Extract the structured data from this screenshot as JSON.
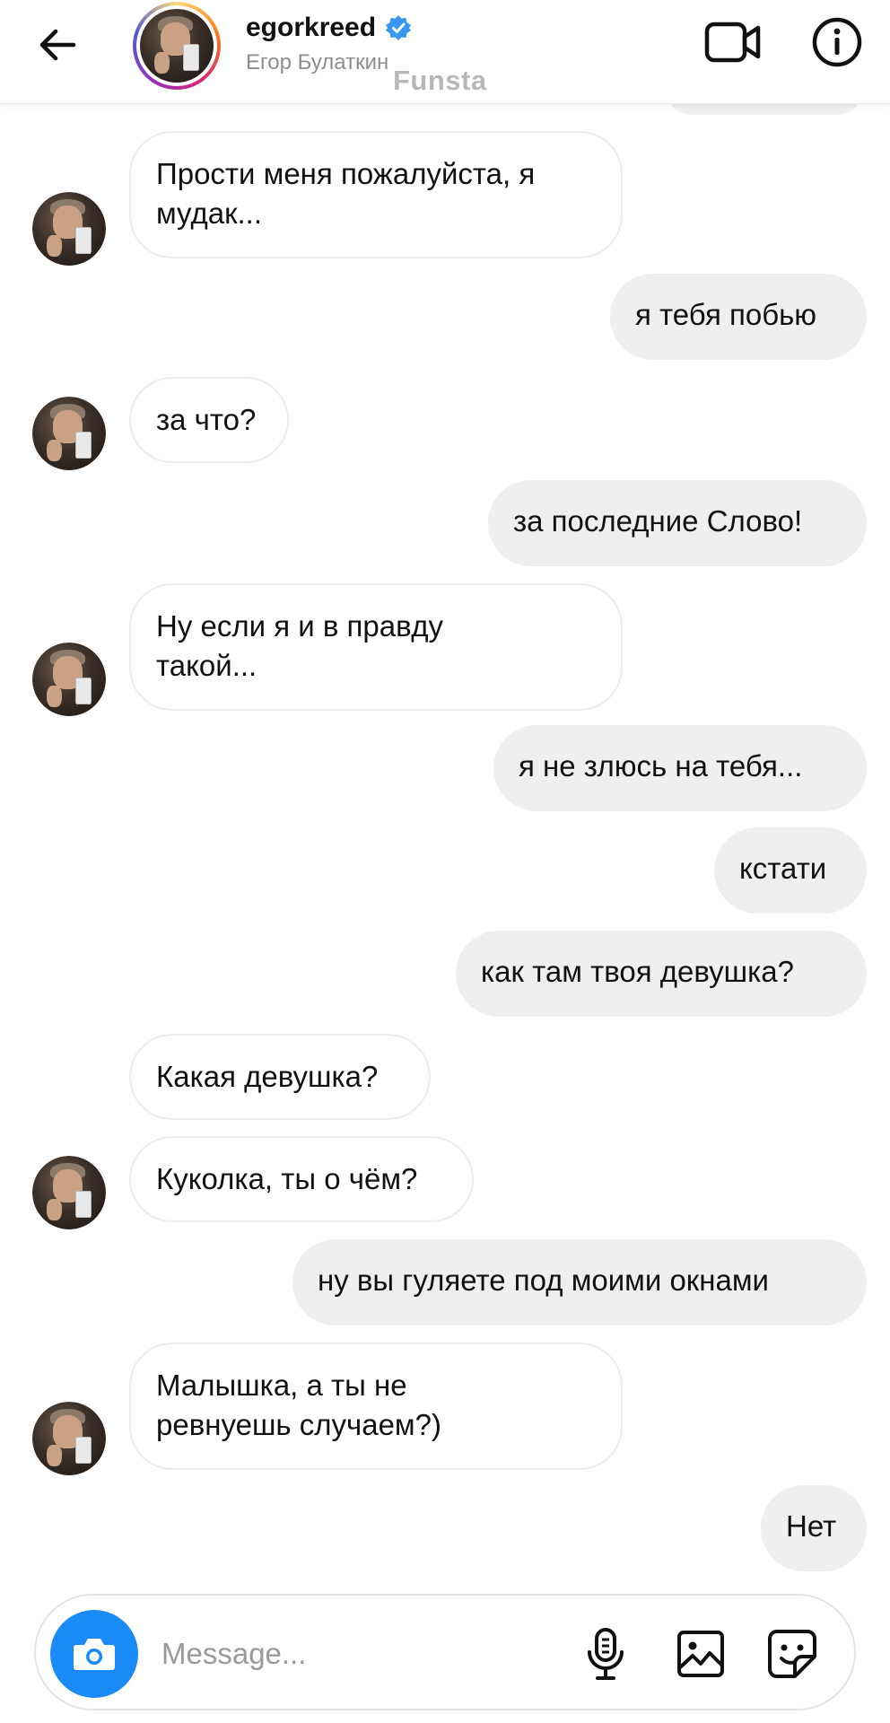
{
  "header": {
    "username": "egorkreed",
    "full_name": "Егор Булаткин",
    "watermark": "Funsta"
  },
  "messages": [
    {
      "side": "in",
      "text": "Прости меня пожалуйста, я\nмудак...",
      "avatar": true
    },
    {
      "side": "out",
      "text": "я тебя побью"
    },
    {
      "side": "in",
      "text": "за что?",
      "avatar": true
    },
    {
      "side": "out",
      "text": "за последние Слово!"
    },
    {
      "side": "in",
      "text": "Ну если я и в правду\nтакой...",
      "avatar": true
    },
    {
      "side": "out",
      "text": "я не злюсь на тебя..."
    },
    {
      "side": "out",
      "text": "кстати"
    },
    {
      "side": "out",
      "text": "как там твоя девушка?"
    },
    {
      "side": "in",
      "text": "Какая девушка?",
      "avatar": false
    },
    {
      "side": "in",
      "text": "Куколка, ты о чём?",
      "avatar": true
    },
    {
      "side": "out",
      "text": "ну вы гуляете под моими окнами"
    },
    {
      "side": "in",
      "text": "Малышка, а ты не\nревнуешь случаем?)",
      "avatar": true
    },
    {
      "side": "out",
      "text": "Нет"
    }
  ],
  "composer": {
    "placeholder": "Message..."
  },
  "colors": {
    "accent_blue": "#1a8bf6",
    "verified_blue": "#3897f0",
    "bubble_out": "#efefef",
    "bubble_in_border": "#ededed"
  }
}
